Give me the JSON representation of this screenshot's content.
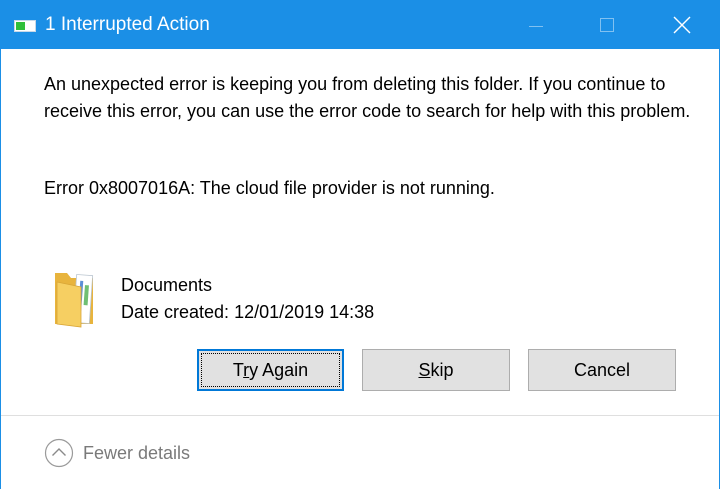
{
  "window": {
    "title": "1 Interrupted Action",
    "icon": "progress-copy-icon",
    "accent_color": "#1b8fe6"
  },
  "message": {
    "body": "An unexpected error is keeping you from deleting this folder. If you continue to receive this error, you can use the error code to search for help with this problem.",
    "error": "Error 0x8007016A: The cloud file provider is not running."
  },
  "item": {
    "icon": "folder-icon",
    "name": "Documents",
    "date_created": "Date created: 12/01/2019 14:38"
  },
  "buttons": {
    "try_again": {
      "prefix": "T",
      "mnemonic": "r",
      "suffix": "y Again"
    },
    "skip": {
      "prefix": "",
      "mnemonic": "S",
      "suffix": "kip"
    },
    "cancel": "Cancel"
  },
  "footer": {
    "details_label": "Fewer details",
    "details_icon": "chevron-up-icon"
  }
}
